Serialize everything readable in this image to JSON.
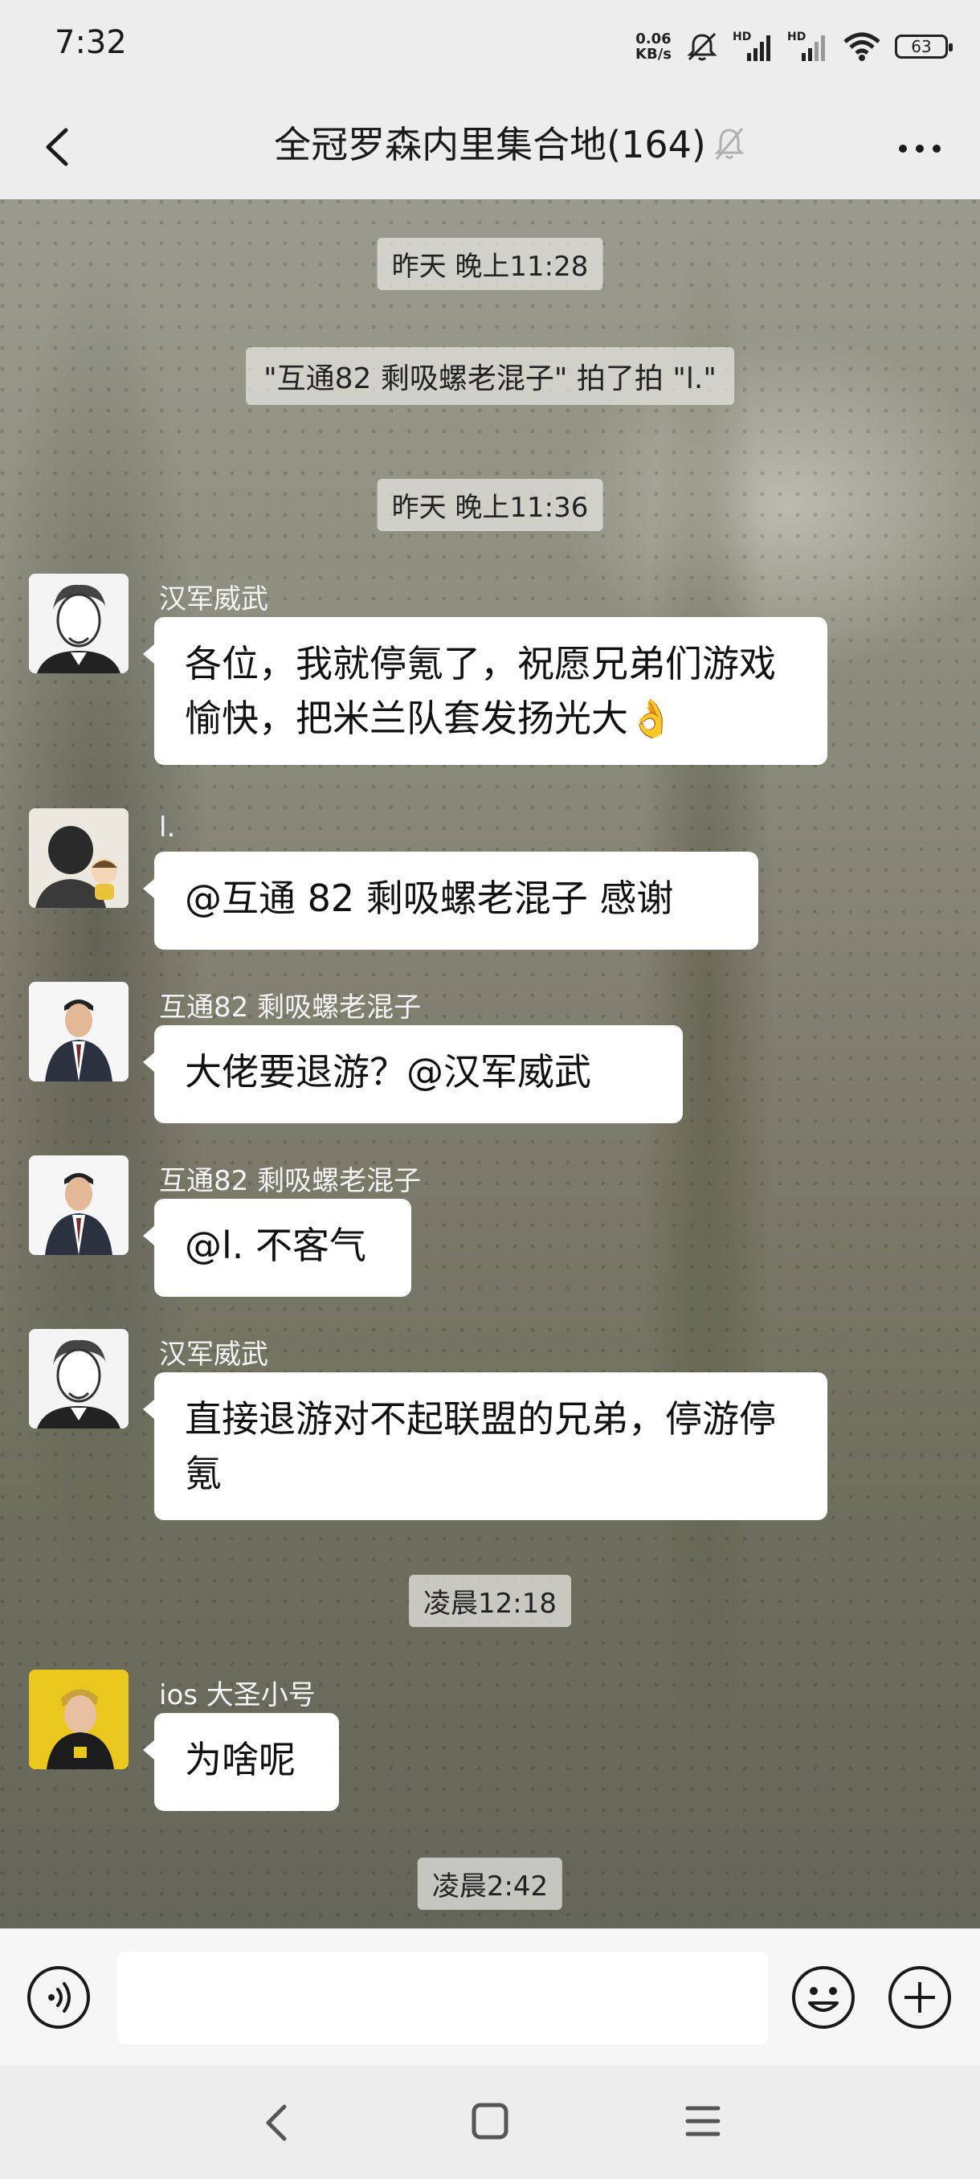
{
  "status": {
    "time": "7:32",
    "net_speed_top": "0.06",
    "net_speed_bottom": "KB/s",
    "hd1": "HD",
    "hd2": "HD",
    "battery": "63"
  },
  "header": {
    "title": "全冠罗森内里集合地(164)"
  },
  "messages": {
    "time1": "昨天 晚上11:28",
    "system1": "\"互通82 剩吸螺老混子\" 拍了拍 \"l.\"",
    "time2": "昨天 晚上11:36",
    "m1_sender": "汉军威武",
    "m1_text": "各位，我就停氪了，祝愿兄弟们游戏愉快，把米兰队套发扬光大👌",
    "m2_sender": "l.",
    "m2_text": "@互通 82 剩吸螺老混子  感谢",
    "m3_sender": "互通82 剩吸螺老混子",
    "m3_text": "大佬要退游？@汉军威武",
    "m4_sender": "互通82 剩吸螺老混子",
    "m4_text": "@l.  不客气",
    "m5_sender": "汉军威武",
    "m5_text": "直接退游对不起联盟的兄弟，停游停氪",
    "time3": "凌晨12:18",
    "m6_sender": "ios 大圣小号",
    "m6_text": "为啥呢",
    "time4": "凌晨2:42"
  },
  "input": {
    "value": "",
    "placeholder": ""
  },
  "icons": {
    "back": "chevron-left-icon",
    "mute": "bell-off-icon",
    "more": "more-dots-icon",
    "voice": "voice-icon",
    "emoji": "emoji-icon",
    "plus": "plus-icon",
    "nav_back": "nav-back-icon",
    "nav_home": "nav-home-icon",
    "nav_menu": "nav-menu-icon"
  }
}
